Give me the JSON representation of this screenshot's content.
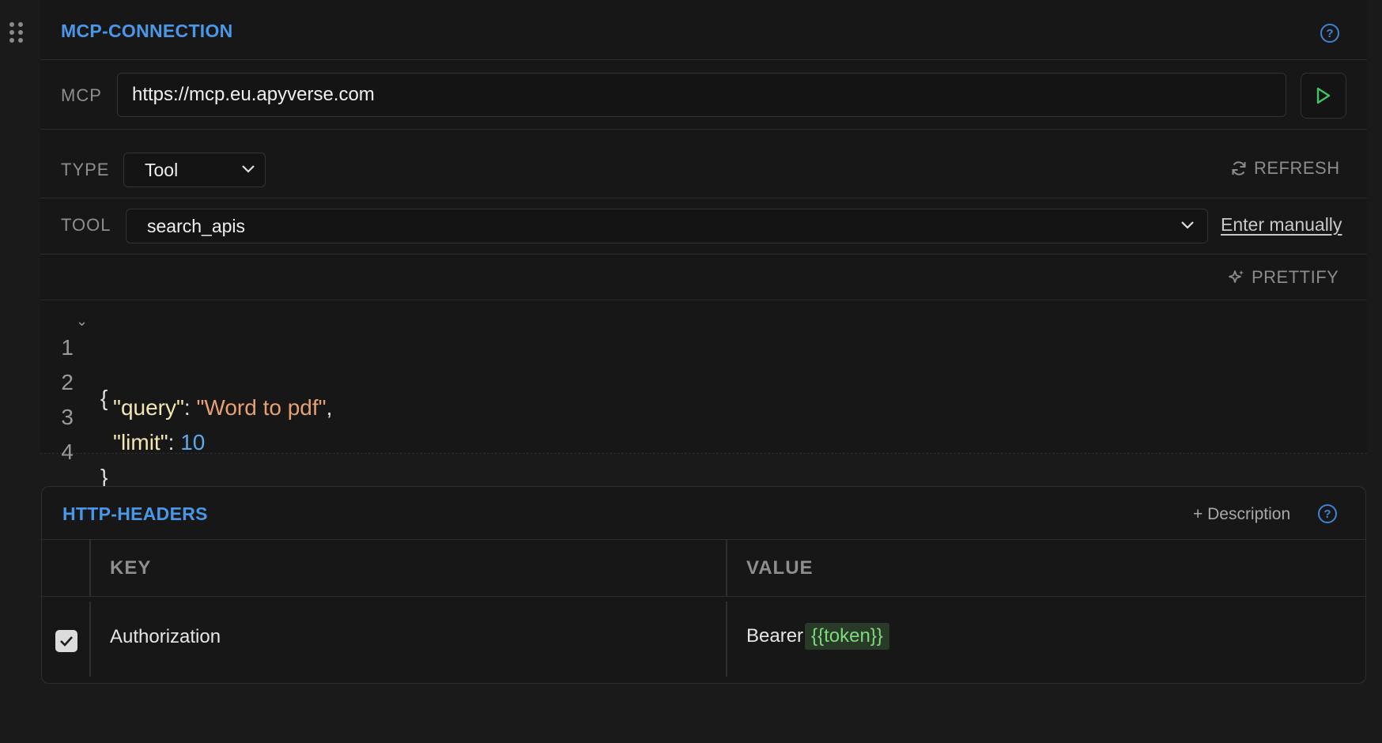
{
  "connection": {
    "title": "MCP-CONNECTION",
    "mcp_label": "MCP",
    "url": "https://mcp.eu.apyverse.com",
    "type_label": "TYPE",
    "type_value": "Tool",
    "refresh_label": "REFRESH",
    "tool_label": "TOOL",
    "tool_value": "search_apis",
    "enter_manually_label": "Enter manually",
    "prettify_label": "PRETTIFY"
  },
  "editor": {
    "lines": [
      {
        "num": "1"
      },
      {
        "num": "2"
      },
      {
        "num": "3"
      },
      {
        "num": "4"
      }
    ],
    "open_brace": "{",
    "close_brace": "}",
    "key_query": "\"query\"",
    "val_query": "\"Word to pdf\"",
    "key_limit": "\"limit\"",
    "val_limit": "10",
    "colon": ": ",
    "comma": ","
  },
  "headers": {
    "title": "HTTP-HEADERS",
    "add_description_label": "+ Description",
    "col_key": "KEY",
    "col_value": "VALUE",
    "rows": [
      {
        "key": "Authorization",
        "value_prefix": "Bearer",
        "value_var": "{{token}}",
        "enabled": true
      }
    ]
  },
  "colors": {
    "accent": "#4a97e8",
    "run_icon": "#43c463",
    "variable": "#7dd97b"
  },
  "icons": {
    "drag": "drag-handle-icon",
    "help": "help-circle-icon",
    "run": "play-icon",
    "dropdown": "chevron-down-icon",
    "refresh": "refresh-icon",
    "prettify": "sparkle-icon",
    "check": "check-icon"
  }
}
